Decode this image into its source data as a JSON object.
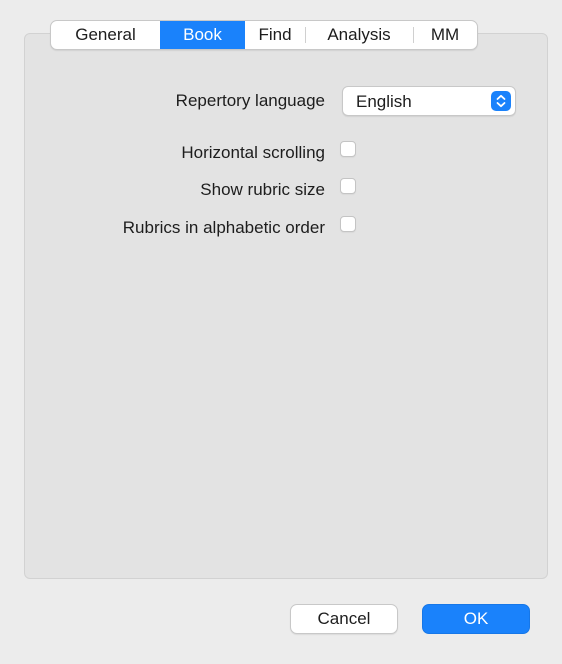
{
  "tabs": [
    {
      "label": "General",
      "selected": false
    },
    {
      "label": "Book",
      "selected": true
    },
    {
      "label": "Find",
      "selected": false
    },
    {
      "label": "Analysis",
      "selected": false
    },
    {
      "label": "MM",
      "selected": false
    }
  ],
  "book": {
    "repertory_language_label": "Repertory language",
    "repertory_language_value": "English",
    "horizontal_scrolling_label": "Horizontal scrolling",
    "horizontal_scrolling_checked": false,
    "show_rubric_size_label": "Show rubric size",
    "show_rubric_size_checked": false,
    "rubrics_alphabetic_label": "Rubrics in alphabetic order",
    "rubrics_alphabetic_checked": false
  },
  "buttons": {
    "cancel_label": "Cancel",
    "ok_label": "OK"
  },
  "colors": {
    "accent": "#1a82fb",
    "window_background": "#ececec",
    "panel_background": "#e3e3e3"
  },
  "icons": {
    "popup_arrows": "up-down-chevron-icon"
  }
}
